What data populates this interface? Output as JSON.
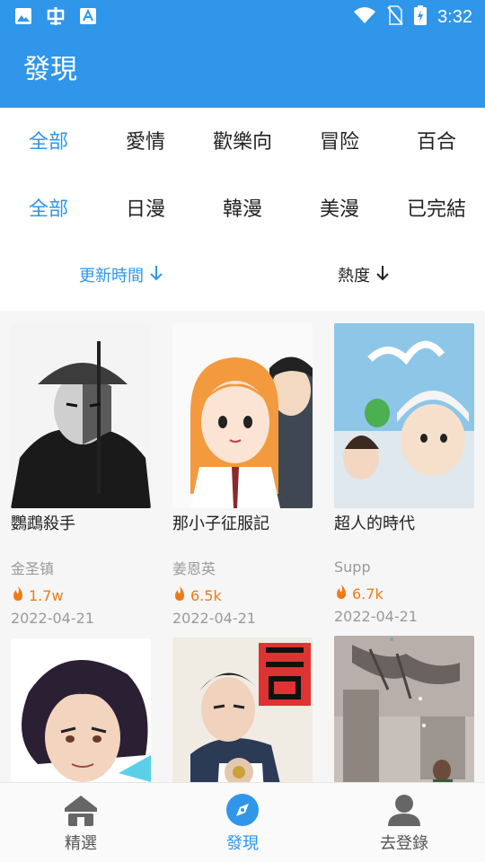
{
  "status_bar": {
    "time": "3:32"
  },
  "header": {
    "title": "發現"
  },
  "filters": {
    "genres": [
      "全部",
      "愛情",
      "歡樂向",
      "冒险",
      "百合"
    ],
    "genres_active": 0,
    "regions": [
      "全部",
      "日漫",
      "韓漫",
      "美漫",
      "已完結"
    ],
    "regions_active": 0,
    "sort": [
      {
        "label": "更新時間",
        "active": true
      },
      {
        "label": "熱度",
        "active": false
      }
    ]
  },
  "comics": [
    {
      "title": "鸚鵡殺手",
      "author": "金圣镇",
      "heat": "1.7w",
      "date": "2022-04-21"
    },
    {
      "title": "那小子征服記",
      "author": "姜恩英",
      "heat": "6.5k",
      "date": "2022-04-21"
    },
    {
      "title": "超人的時代",
      "author": "Supp",
      "heat": "6.7k",
      "date": "2022-04-21"
    },
    {
      "title": "",
      "author": "",
      "heat": "",
      "date": ""
    },
    {
      "title": "",
      "author": "",
      "heat": "",
      "date": ""
    },
    {
      "title": "",
      "author": "",
      "heat": "",
      "date": ""
    }
  ],
  "bottom_nav": {
    "items": [
      {
        "label": "精選",
        "icon": "home-icon"
      },
      {
        "label": "發現",
        "icon": "compass-icon"
      },
      {
        "label": "去登錄",
        "icon": "person-icon"
      }
    ],
    "active": 1
  },
  "colors": {
    "accent": "#2f96ea",
    "heat": "#f07a18"
  }
}
